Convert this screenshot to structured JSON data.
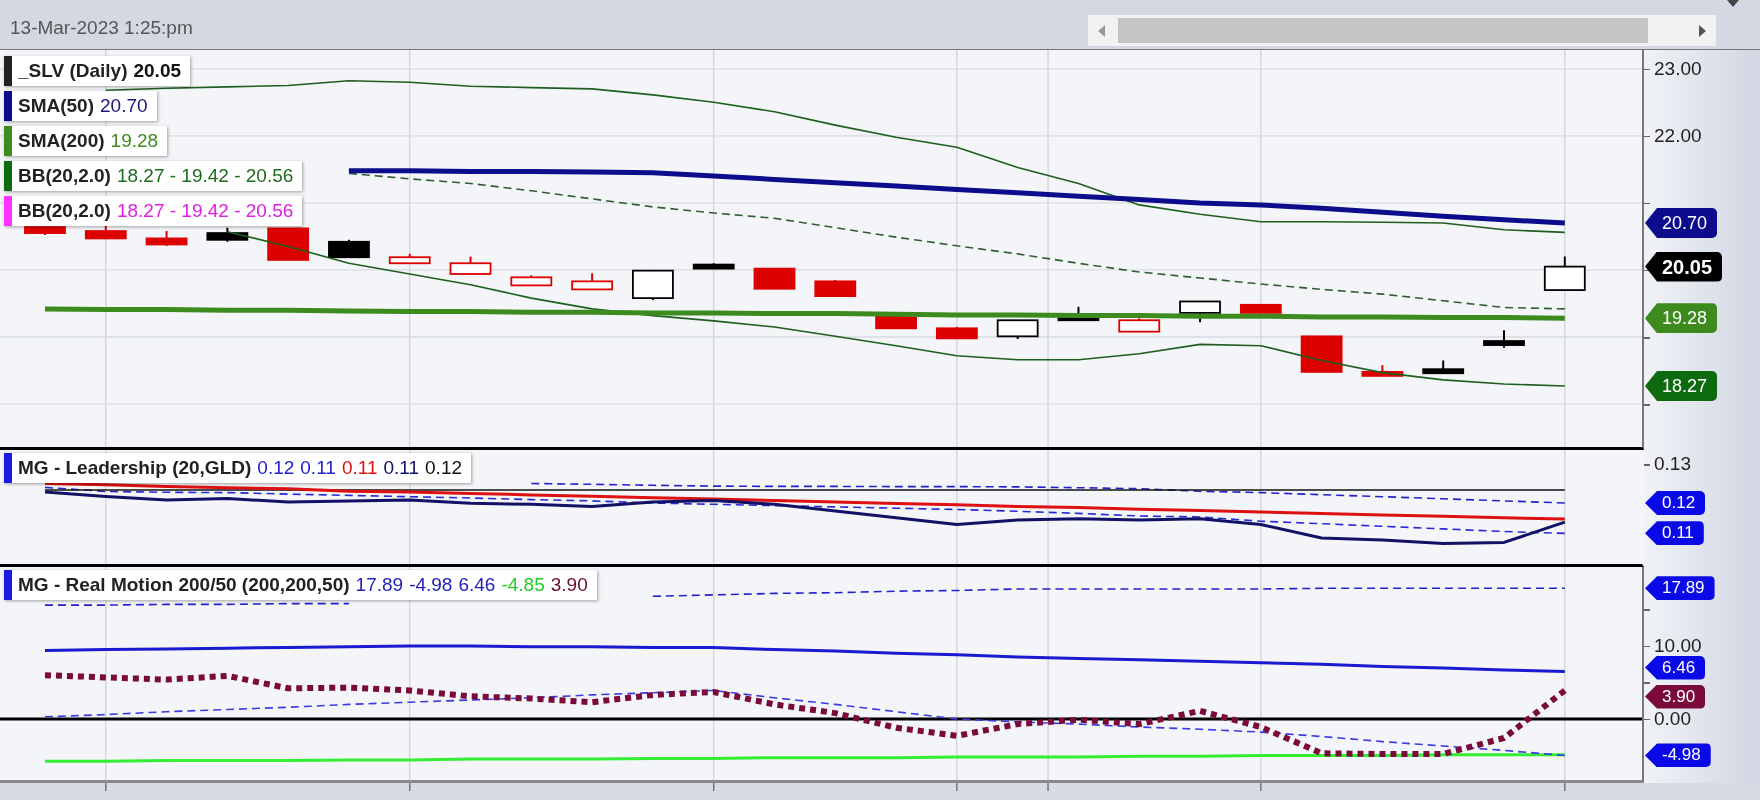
{
  "header": {
    "timestamp": "13-Mar-2023 1:25:pm"
  },
  "panels": [
    {
      "legend": [
        {
          "name": "_SLV (Daily)",
          "color": "#222222",
          "values": [
            {
              "text": "20.05",
              "color": "#111111",
              "bold": true
            }
          ]
        },
        {
          "name": "SMA(50)",
          "color": "#0c0c8c",
          "values": [
            {
              "text": "20.70",
              "color": "#1a1a7a",
              "bold": false
            }
          ]
        },
        {
          "name": "SMA(200)",
          "color": "#3d8a1e",
          "values": [
            {
              "text": "19.28",
              "color": "#3d8a1e",
              "bold": false
            }
          ]
        },
        {
          "name": "BB(20,2.0)",
          "color": "#0e6a0e",
          "values": [
            {
              "text": "18.27 - 19.42 - 20.56",
              "color": "#1e6a1e",
              "bold": false
            }
          ]
        },
        {
          "name": "BB(20,2.0)",
          "color": "#ff33ff",
          "values": [
            {
              "text": "18.27 - 19.42 - 20.56",
              "color": "#e020e0",
              "bold": false
            }
          ]
        }
      ],
      "tags": [
        {
          "text": "20.70",
          "color": "#0c0c8c",
          "bold": false
        },
        {
          "text": "20.05",
          "color": "#000000",
          "bold": true
        },
        {
          "text": "19.28",
          "color": "#3d8a1e",
          "bold": false
        },
        {
          "text": "18.27",
          "color": "#0e6a0e",
          "bold": false
        }
      ],
      "chart_data": {
        "type": "line",
        "grid": true,
        "categories": [
          null,
          null,
          null,
          null,
          null,
          null,
          null,
          null,
          null,
          null,
          null,
          null,
          null,
          null,
          null,
          null,
          null,
          null,
          null,
          null,
          null,
          null,
          null,
          null,
          null,
          null
        ],
        "ylim": [
          17.36,
          23.28
        ],
        "yticks": [
          {
            "value": 23,
            "label": "23.00"
          },
          {
            "value": 22,
            "label": "22.00"
          }
        ],
        "series": [
          {
            "color": "#1e5e1e",
            "line_style": "solid",
            "values": [
              null,
              22.68,
              22.71,
              22.73,
              22.75,
              22.82,
              22.8,
              22.74,
              22.72,
              22.7,
              22.61,
              22.5,
              22.36,
              22.16,
              21.98,
              21.83,
              21.53,
              21.29,
              20.97,
              20.83,
              20.72,
              20.72,
              20.71,
              20.7,
              20.6,
              20.56
            ]
          },
          {
            "color": "#2f5f2f",
            "line_style": "dashed",
            "values": [
              null,
              null,
              null,
              null,
              null,
              21.44,
              21.36,
              21.29,
              21.18,
              21.06,
              20.94,
              20.85,
              20.77,
              20.63,
              20.49,
              20.36,
              20.24,
              20.1,
              19.97,
              19.88,
              19.79,
              19.71,
              19.64,
              19.54,
              19.44,
              19.42
            ]
          },
          {
            "color": "#1e5e1e",
            "line_style": "solid",
            "values": [
              null,
              null,
              null,
              20.57,
              20.35,
              20.1,
              19.94,
              19.78,
              19.58,
              19.42,
              19.32,
              19.24,
              19.15,
              19.01,
              18.87,
              18.72,
              18.66,
              18.66,
              18.75,
              18.89,
              18.87,
              18.65,
              18.47,
              18.36,
              18.3,
              18.27
            ]
          },
          {
            "color": "#3d8a1e",
            "line_style": "solid",
            "values": [
              19.42,
              19.41,
              19.41,
              19.4,
              19.4,
              19.39,
              19.38,
              19.38,
              19.37,
              19.37,
              19.36,
              19.36,
              19.35,
              19.35,
              19.34,
              19.33,
              19.33,
              19.32,
              19.32,
              19.31,
              19.31,
              19.3,
              19.3,
              19.29,
              19.29,
              19.28
            ]
          },
          {
            "color": "#0c0c8c",
            "line_style": "solid",
            "values": [
              null,
              null,
              null,
              null,
              null,
              21.48,
              21.48,
              21.47,
              21.47,
              21.46,
              21.45,
              21.4,
              21.35,
              21.3,
              21.25,
              21.2,
              21.15,
              21.1,
              21.05,
              21.0,
              20.97,
              20.92,
              20.86,
              20.8,
              20.75,
              20.7
            ]
          }
        ]
      }
    },
    {
      "legend": [
        {
          "name": "MG - Leadership (20,GLD)",
          "color": "#1a1ae0",
          "values": [
            {
              "text": "0.12",
              "color": "#2222cc",
              "bold": false
            },
            {
              "text": "0.11",
              "color": "#2222cc",
              "bold": false
            },
            {
              "text": "0.11",
              "color": "#dd1111",
              "bold": false
            },
            {
              "text": "0.11",
              "color": "#111166",
              "bold": false
            },
            {
              "text": "0.12",
              "color": "#111111",
              "bold": false
            }
          ]
        }
      ],
      "tags": [
        {
          "text": "0.12",
          "color": "#0a0ae6",
          "bold": false
        },
        {
          "text": "0.11",
          "color": "#0a0ae6",
          "bold": false
        }
      ],
      "axis_labels": [
        "0.13"
      ]
    },
    {
      "legend": [
        {
          "name": "MG - Real Motion 200/50 (200,200,50)",
          "color": "#1a1ae0",
          "values": [
            {
              "text": "17.89",
              "color": "#2222bb",
              "bold": false
            },
            {
              "text": "-4.98",
              "color": "#2222bb",
              "bold": false
            },
            {
              "text": "6.46",
              "color": "#2222bb",
              "bold": false
            },
            {
              "text": "-4.85",
              "color": "#22cc22",
              "bold": false
            },
            {
              "text": "3.90",
              "color": "#6a0a30",
              "bold": false
            }
          ]
        }
      ],
      "tags": [
        {
          "text": "17.89",
          "color": "#0a0ae6",
          "bold": false
        },
        {
          "text": "6.46",
          "color": "#0a0ae6",
          "bold": false
        },
        {
          "text": "3.90",
          "color": "#7a0a3a",
          "bold": false
        },
        {
          "text": "-4.98",
          "color": "#0a0ae6",
          "bold": false
        }
      ],
      "chart_data": {
        "type": "line",
        "grid": true,
        "categories": [
          null,
          null,
          null,
          null,
          null,
          null,
          null,
          null,
          null,
          null,
          null,
          null,
          null,
          null,
          null,
          null,
          null,
          null,
          null,
          null,
          null,
          null,
          null,
          null,
          null,
          null
        ],
        "ylim": [
          -8.36,
          20.82
        ],
        "yticks": [
          {
            "value": 10,
            "label": "10.00"
          },
          {
            "value": 0,
            "label": "0.00"
          }
        ],
        "series": [
          {
            "color": "#2222cc",
            "line_style": "dashed",
            "values": [
              15.6,
              15.6,
              15.7,
              15.7,
              15.8,
              15.8,
              null,
              null,
              null,
              null,
              16.8,
              17.0,
              17.2,
              17.3,
              17.5,
              17.6,
              17.8,
              17.8,
              17.8,
              17.8,
              17.8,
              17.9,
              17.9,
              17.9,
              17.9,
              17.9
            ]
          },
          {
            "color": "#1a1ad0",
            "line_style": "solid",
            "values": [
              9.4,
              9.5,
              9.6,
              9.7,
              9.8,
              9.9,
              10.0,
              10.0,
              9.9,
              9.9,
              9.8,
              9.8,
              9.5,
              9.3,
              9.0,
              8.8,
              8.5,
              8.3,
              8.1,
              7.9,
              7.7,
              7.5,
              7.2,
              7.0,
              6.7,
              6.5
            ]
          },
          {
            "color": "#33ee33",
            "line_style": "solid",
            "values": [
              -5.8,
              -5.8,
              -5.7,
              -5.7,
              -5.7,
              -5.6,
              -5.6,
              -5.5,
              -5.5,
              -5.5,
              -5.4,
              -5.4,
              -5.3,
              -5.3,
              -5.3,
              -5.2,
              -5.2,
              -5.2,
              -5.1,
              -5.1,
              -5.0,
              -5.0,
              -5.0,
              -4.9,
              -4.9,
              -4.9
            ]
          },
          {
            "color": "#3a3ae0",
            "line_style": "dashed",
            "values": [
              0.3,
              0.6,
              1.0,
              1.3,
              1.6,
              2.0,
              2.3,
              2.6,
              2.9,
              3.3,
              3.6,
              3.9,
              2.9,
              2.0,
              1.0,
              0.0,
              -0.4,
              -0.7,
              -1.1,
              -1.4,
              -1.8,
              -2.4,
              -3.1,
              -3.7,
              -4.3,
              -5.0
            ]
          },
          {
            "color": "#7a0a3a",
            "line_style": "dotted",
            "values": [
              6.0,
              5.7,
              5.4,
              5.9,
              4.2,
              4.3,
              3.9,
              3.1,
              2.8,
              2.3,
              3.3,
              3.7,
              2.0,
              0.8,
              -1.2,
              -2.3,
              -0.7,
              -0.1,
              -0.7,
              1.1,
              -1.1,
              -4.7,
              -4.8,
              -4.8,
              -2.6,
              3.9
            ]
          }
        ]
      }
    }
  ]
}
